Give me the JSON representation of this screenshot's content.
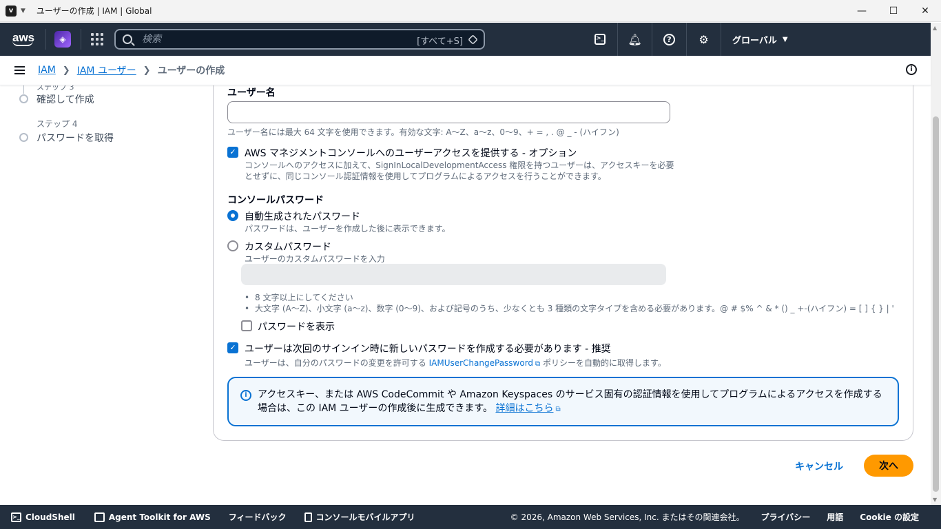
{
  "window": {
    "title": "ユーザーの作成 | IAM | Global",
    "app_icon": "v",
    "controls": [
      "—",
      "☐",
      "✕"
    ]
  },
  "nav": {
    "logo": "aws",
    "search_placeholder": "検索",
    "search_shortcut": "[すべて+S]",
    "region": "グローバル"
  },
  "breadcrumb": {
    "items": [
      "IAM",
      "IAM ユーザー"
    ],
    "current": "ユーザーの作成"
  },
  "steps": [
    {
      "label": "ステップ 3",
      "title": "確認して作成"
    },
    {
      "label": "ステップ 4",
      "title": "パスワードを取得"
    }
  ],
  "form": {
    "username_label": "ユーザー名",
    "username_value": "",
    "username_hint": "ユーザー名には最大 64 文字を使用できます。有効な文字: A〜Z、a〜z、0〜9、+ = , . @ _ - (ハイフン)",
    "console_access": {
      "checked": true,
      "label": "AWS マネジメントコンソールへのユーザーアクセスを提供する - オプション",
      "desc1": "コンソールへのアクセスに加えて、SignInLocalDevelopmentAccess 権限を持つユーザーは、アクセスキーを必要",
      "desc2": "とせずに、同じコンソール認証情報を使用してプログラムによるアクセスを行うことができます。"
    },
    "console_password_label": "コンソールパスワード",
    "auto_password": {
      "selected": true,
      "label": "自動生成されたパスワード",
      "desc": "パスワードは、ユーザーを作成した後に表示できます。"
    },
    "custom_password": {
      "selected": false,
      "label": "カスタムパスワード",
      "desc": "ユーザーのカスタムパスワードを入力",
      "value": ""
    },
    "password_rules": [
      "8 文字以上にしてください",
      "大文字 (A〜Z)、小文字 (a〜z)、数字 (0〜9)、および記号のうち、少なくとも 3 種類の文字タイプを含める必要があります。@ # $% ^ & * () _ +-(ハイフン) = [ ] { } | '"
    ],
    "show_password": {
      "checked": false,
      "label": "パスワードを表示"
    },
    "require_reset": {
      "checked": true,
      "label": "ユーザーは次回のサインイン時に新しいパスワードを作成する必要があります - 推奨",
      "desc_prefix": "ユーザーは、自分のパスワードの変更を許可する",
      "desc_link": "IAMUserChangePassword",
      "desc_suffix": "ポリシーを自動的に取得します。"
    }
  },
  "alert": {
    "text": "アクセスキー、または AWS CodeCommit や Amazon Keyspaces のサービス固有の認証情報を使用してプログラムによるアクセスを作成する場合は、この IAM ユーザーの作成後に生成できます。",
    "link": "詳細はこちら"
  },
  "actions": {
    "cancel": "キャンセル",
    "next": "次へ"
  },
  "footer": {
    "cloudshell": "CloudShell",
    "agent_toolkit": "Agent Toolkit for AWS",
    "feedback": "フィードバック",
    "mobile_app": "コンソールモバイルアプリ",
    "copyright": "© 2026, Amazon Web Services, Inc. またはその関連会社。",
    "privacy": "プライバシー",
    "terms": "用語",
    "cookie": "Cookie の設定"
  },
  "colors": {
    "nav_bg": "#232f3e",
    "accent_blue": "#0972d3",
    "primary_button": "#ff9900"
  }
}
